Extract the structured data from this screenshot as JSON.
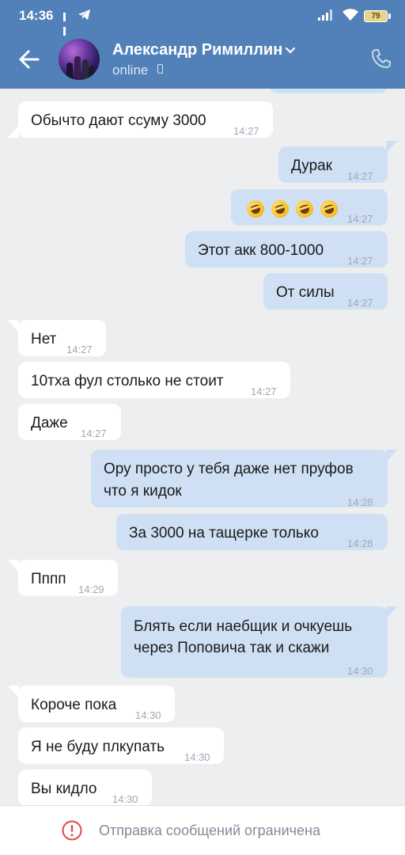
{
  "status_bar": {
    "time": "14:36",
    "battery": "79"
  },
  "header": {
    "contact_name": "Александр Римиллин",
    "status": "online"
  },
  "messages": [
    {
      "dir": "in",
      "text": "Обычто дают ссуму 3000",
      "time": "14:27"
    },
    {
      "dir": "out",
      "text": "Дурак",
      "time": "14:27"
    },
    {
      "dir": "out",
      "emoji": "rolling-on-floor-laughing x4",
      "time": "14:27"
    },
    {
      "dir": "out",
      "text": "Этот акк 800-1000",
      "time": "14:27"
    },
    {
      "dir": "out",
      "text": "От силы",
      "time": "14:27"
    },
    {
      "dir": "in",
      "text": "Нет",
      "time": "14:27"
    },
    {
      "dir": "in",
      "text": "10тха фул столько не стоит",
      "time": "14:27"
    },
    {
      "dir": "in",
      "text": "Даже",
      "time": "14:27"
    },
    {
      "dir": "out",
      "line1": "Ору просто у тебя даже нет пруфов",
      "line2": "что я кидок",
      "time": "14:28"
    },
    {
      "dir": "out",
      "text": "За 3000 на тащерке только",
      "time": "14:28"
    },
    {
      "dir": "in",
      "text": "Пппп",
      "time": "14:29"
    },
    {
      "dir": "out",
      "line1": "Блять если наебщик и очкуешь",
      "line2": "через Поповича так и скажи",
      "time": "14:30"
    },
    {
      "dir": "in",
      "text": "Короче пока",
      "time": "14:30"
    },
    {
      "dir": "in",
      "text": "Я не буду плкупать",
      "time": "14:30"
    },
    {
      "dir": "in",
      "text": "Вы кидло",
      "time": "14:30"
    }
  ],
  "footer": {
    "notice": "Отправка сообщений ограничена",
    "icon": "warning-circle-icon"
  },
  "colors": {
    "header": "#5181b8",
    "background": "#edeef0",
    "outgoing_bubble": "#cfe0f4",
    "incoming_bubble": "#ffffff",
    "warning": "#e64646"
  }
}
